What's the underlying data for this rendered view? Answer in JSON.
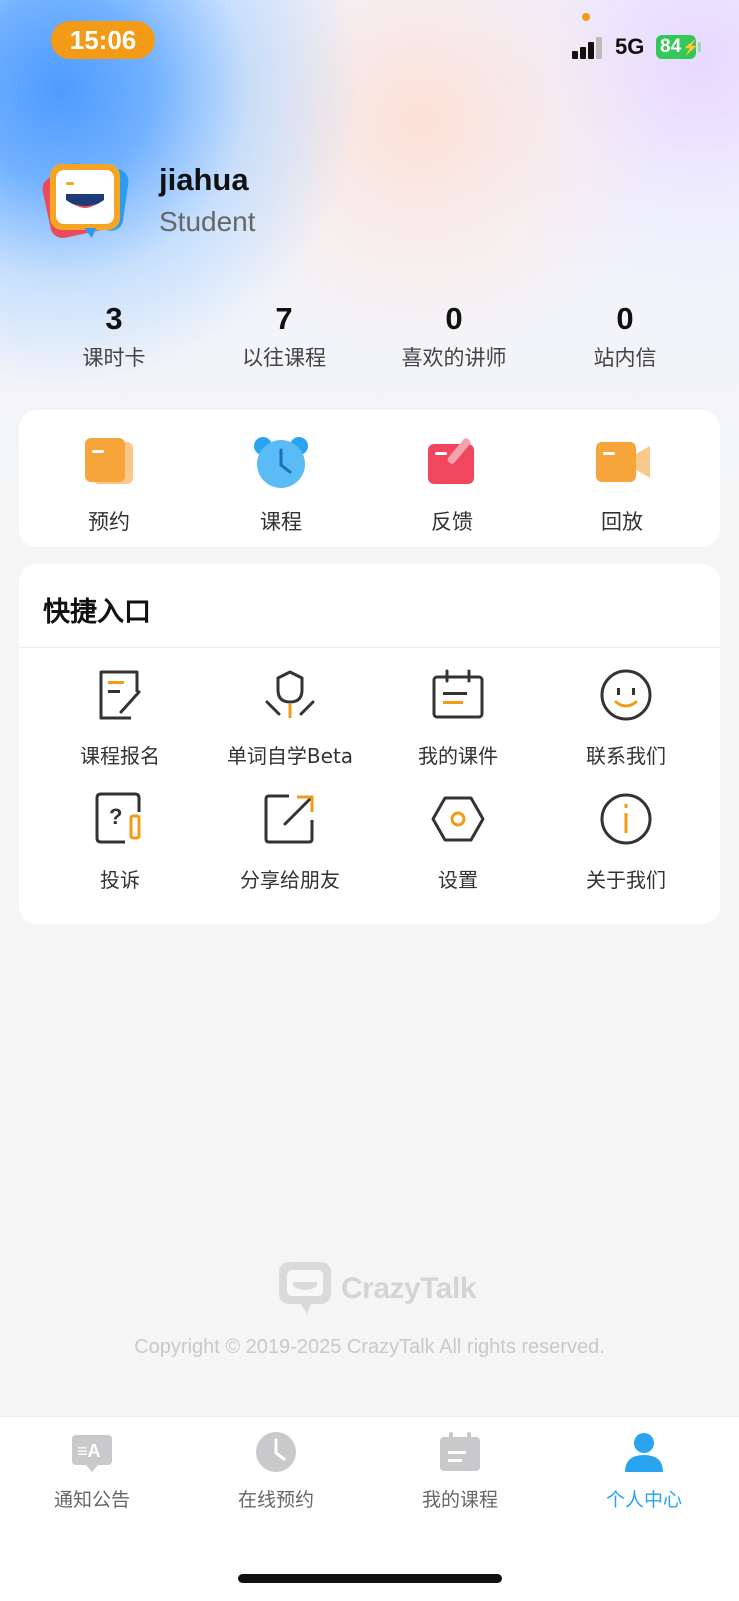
{
  "status_bar": {
    "time": "15:06",
    "network": "5G",
    "battery": "84",
    "battery_icon": "charging-battery"
  },
  "profile": {
    "username": "jiahua",
    "role": "Student"
  },
  "stats": [
    {
      "value": "3",
      "label": "课时卡"
    },
    {
      "value": "7",
      "label": "以往课程"
    },
    {
      "value": "0",
      "label": "喜欢的讲师"
    },
    {
      "value": "0",
      "label": "站内信"
    }
  ],
  "quick_actions": [
    {
      "label": "预约",
      "icon": "calendar-note-icon"
    },
    {
      "label": "课程",
      "icon": "alarm-clock-icon"
    },
    {
      "label": "反馈",
      "icon": "feedback-edit-icon"
    },
    {
      "label": "回放",
      "icon": "video-camera-icon"
    }
  ],
  "shortcuts": {
    "title": "快捷入口",
    "items": [
      {
        "label": "课程报名",
        "icon": "signup-edit-icon"
      },
      {
        "label": "单词自学Beta",
        "icon": "tulip-icon"
      },
      {
        "label": "我的课件",
        "icon": "courseware-calendar-icon"
      },
      {
        "label": "联系我们",
        "icon": "smiley-icon"
      },
      {
        "label": "投诉",
        "icon": "complaint-question-icon"
      },
      {
        "label": "分享给朋友",
        "icon": "share-icon"
      },
      {
        "label": "设置",
        "icon": "settings-hexagon-icon"
      },
      {
        "label": "关于我们",
        "icon": "info-icon"
      }
    ]
  },
  "footer": {
    "brand": "CrazyTalk",
    "copyright": "Copyright © 2019-2025 CrazyTalk All rights reserved."
  },
  "tabbar": {
    "items": [
      {
        "label": "通知公告",
        "icon": "announcement-icon",
        "active": false
      },
      {
        "label": "在线预约",
        "icon": "clock-icon",
        "active": false
      },
      {
        "label": "我的课程",
        "icon": "calendar-icon",
        "active": false
      },
      {
        "label": "个人中心",
        "icon": "person-icon",
        "active": true
      }
    ]
  },
  "colors": {
    "accent": "#f39a16",
    "active_tab": "#2aa3f0",
    "battery": "#34c759"
  }
}
